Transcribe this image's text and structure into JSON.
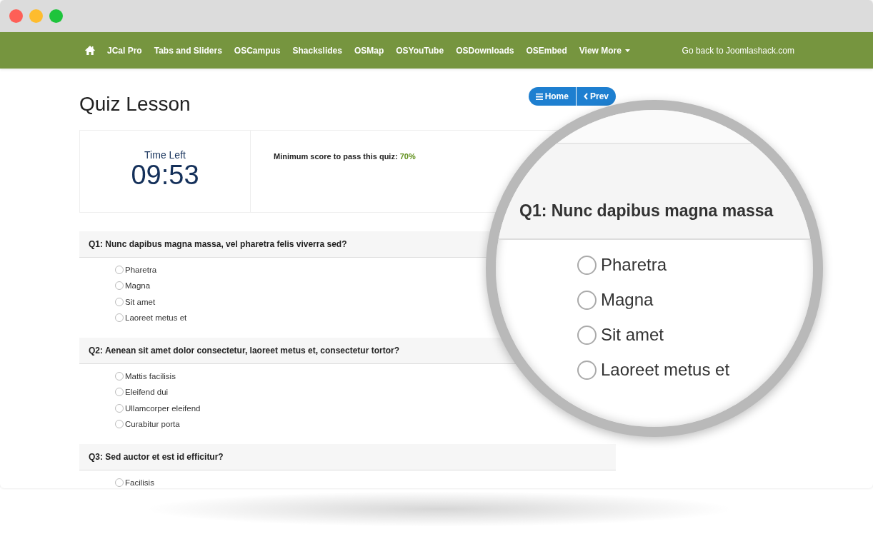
{
  "nav": {
    "items": [
      {
        "kind": "home"
      },
      {
        "kind": "link",
        "label": "JCal Pro"
      },
      {
        "kind": "link",
        "label": "Tabs and Sliders"
      },
      {
        "kind": "link",
        "label": "OSCampus"
      },
      {
        "kind": "link",
        "label": "Shackslides"
      },
      {
        "kind": "link",
        "label": "OSMap"
      },
      {
        "kind": "link",
        "label": "OSYouTube"
      },
      {
        "kind": "link",
        "label": "OSDownloads"
      },
      {
        "kind": "link",
        "label": "OSEmbed"
      },
      {
        "kind": "dropdown",
        "label": "View More"
      }
    ],
    "right_link": "Go back to Joomlashack.com"
  },
  "page": {
    "title": "Quiz Lesson",
    "buttons": [
      {
        "kind": "menu",
        "label": "Home"
      },
      {
        "kind": "back",
        "label": "Prev"
      }
    ],
    "timer": {
      "label": "Time Left",
      "value": "09:53"
    },
    "min_score": {
      "label": "Minimum score to pass this quiz:",
      "value": "70%"
    },
    "questions": [
      {
        "title": "Q1: Nunc dapibus magna massa, vel pharetra felis viverra sed?",
        "options": [
          {
            "label": "Pharetra",
            "selected": false
          },
          {
            "label": "Magna",
            "selected": false
          },
          {
            "label": "Sit amet",
            "selected": false
          },
          {
            "label": "Laoreet metus et",
            "selected": false
          }
        ]
      },
      {
        "title": "Q2: Aenean sit amet dolor consectetur, laoreet metus et, consectetur tortor?",
        "options": [
          {
            "label": "Mattis facilisis",
            "selected": false
          },
          {
            "label": "Eleifend dui",
            "selected": false
          },
          {
            "label": "Ullamcorper eleifend",
            "selected": false
          },
          {
            "label": "Curabitur porta",
            "selected": false
          }
        ]
      },
      {
        "title": "Q3: Sed auctor et est id efficitur?",
        "options": [
          {
            "label": "Facilisis",
            "selected": false
          }
        ]
      }
    ]
  },
  "magnifier": {
    "title": "Q1: Nunc dapibus magna massa",
    "options": [
      {
        "label": "Pharetra",
        "selected": false
      },
      {
        "label": "Magna",
        "selected": false
      },
      {
        "label": "Sit amet",
        "selected": false
      },
      {
        "label": "Laoreet metus et",
        "selected": false
      }
    ]
  }
}
